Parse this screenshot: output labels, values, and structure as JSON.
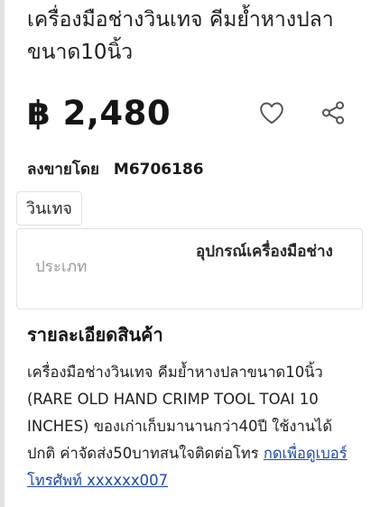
{
  "product": {
    "title": "เครื่องมือช่างวินเทจ คีมย้ำหางปลาขนาด10นิ้ว",
    "price": "฿ 2,480",
    "seller_prefix": "ลงขายโดย",
    "seller_id": "M6706186",
    "tag": "วินเทจ",
    "category_label": "ประเภท",
    "category_value": "อุปกรณ์เครื่องมือช่าง"
  },
  "details": {
    "heading": "รายละเอียดสินค้า",
    "body": "เครื่องมือช่างวินเทจ คีมย้ำหางปลาขนาด10นิ้ว (RARE OLD HAND CRIMP TOOL TOAI 10 INCHES) ของเก่าเก็บมานานกว่า40ปี ใช้งานได้ปกติ ค่าจัดส่ง50บาทสนใจติดต่อโทร ",
    "phone_link": "กดเพื่อดูเบอร์โทรศัพท์ xxxxxx007"
  },
  "icons": {
    "favorite": "heart-icon",
    "share": "share-icon",
    "icon_color": "#555555"
  }
}
